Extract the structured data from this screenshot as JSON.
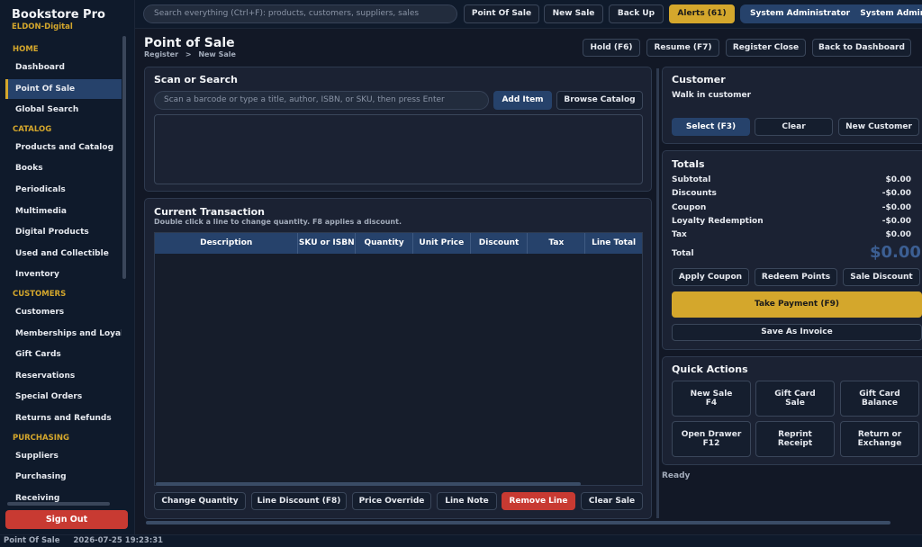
{
  "app": {
    "name": "Bookstore Pro",
    "tenant": "ELDON-Digital",
    "sign_out": "Sign Out"
  },
  "sidebar": {
    "sections": [
      {
        "title": "HOME",
        "items": [
          "Dashboard",
          "Point Of Sale",
          "Global Search"
        ]
      },
      {
        "title": "CATALOG",
        "items": [
          "Products and Catalog",
          "Books",
          "Periodicals",
          "Multimedia",
          "Digital Products",
          "Used and Collectible",
          "Inventory"
        ]
      },
      {
        "title": "CUSTOMERS",
        "items": [
          "Customers",
          "Memberships and Loyalty",
          "Gift Cards",
          "Reservations",
          "Special Orders",
          "Returns and Refunds"
        ]
      },
      {
        "title": "PURCHASING",
        "items": [
          "Suppliers",
          "Purchasing",
          "Receiving"
        ]
      }
    ],
    "active_item": "Point Of Sale"
  },
  "topbar": {
    "search_placeholder": "Search everything (Ctrl+F): products, customers, suppliers, sales",
    "point_of_sale": "Point Of Sale",
    "new_sale": "New Sale",
    "back_up": "Back Up",
    "alerts": "Alerts (61)",
    "user_name": "System Administrator",
    "user_role": "System Administrator"
  },
  "header": {
    "title": "Point of Sale",
    "breadcrumb": [
      "Register",
      "New Sale"
    ],
    "breadcrumb_sep": ">",
    "hold": "Hold (F6)",
    "resume": "Resume (F7)",
    "register_close": "Register Close",
    "back_to_dashboard": "Back to Dashboard"
  },
  "scan": {
    "title": "Scan or Search",
    "placeholder": "Scan a barcode or type a title, author, ISBN, or SKU, then press Enter",
    "add_item": "Add Item",
    "browse_catalog": "Browse Catalog"
  },
  "transaction": {
    "title": "Current Transaction",
    "hint": "Double click a line to change quantity. F8 applies a discount.",
    "columns": [
      "Description",
      "SKU or ISBN",
      "Quantity",
      "Unit Price",
      "Discount",
      "Tax",
      "Line Total"
    ],
    "rows": [],
    "actions": {
      "change_quantity": "Change Quantity",
      "line_discount": "Line Discount (F8)",
      "price_override": "Price Override",
      "line_note": "Line Note",
      "remove_line": "Remove Line",
      "clear_sale": "Clear Sale"
    }
  },
  "customer": {
    "title": "Customer",
    "name": "Walk in customer",
    "select": "Select (F3)",
    "clear": "Clear",
    "new_customer": "New Customer"
  },
  "totals": {
    "title": "Totals",
    "lines": [
      {
        "label": "Subtotal",
        "value": "$0.00"
      },
      {
        "label": "Discounts",
        "value": "-$0.00"
      },
      {
        "label": "Coupon",
        "value": "-$0.00"
      },
      {
        "label": "Loyalty Redemption",
        "value": "-$0.00"
      },
      {
        "label": "Tax",
        "value": "$0.00"
      }
    ],
    "total_label": "Total",
    "total_value": "$0.00",
    "apply_coupon": "Apply Coupon",
    "redeem_points": "Redeem Points",
    "sale_discount": "Sale Discount",
    "take_payment": "Take Payment  (F9)",
    "save_as_invoice": "Save As Invoice"
  },
  "quick_actions": {
    "title": "Quick Actions",
    "items": [
      {
        "line1": "New Sale",
        "line2": "F4"
      },
      {
        "line1": "Gift Card",
        "line2": "Sale"
      },
      {
        "line1": "Gift Card",
        "line2": "Balance"
      },
      {
        "line1": "Open Drawer",
        "line2": "F12"
      },
      {
        "line1": "Reprint",
        "line2": "Receipt"
      },
      {
        "line1": "Return or",
        "line2": "Exchange"
      }
    ]
  },
  "status": {
    "ready": "Ready",
    "mode": "Point Of Sale",
    "datetime": "2026-07-25 19:23:31"
  },
  "colors": {
    "accent_gold": "#d4a72c",
    "primary_blue": "#26426b",
    "danger_red": "#c83a32",
    "background": "#121826"
  }
}
